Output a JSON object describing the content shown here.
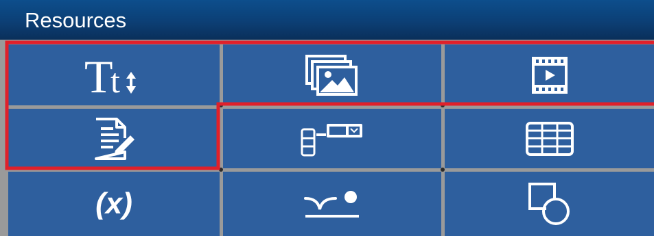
{
  "panel": {
    "title": "Resources"
  },
  "colors": {
    "header_top": "#0d4e8c",
    "header_bottom": "#0a2f5a",
    "tile": "#2e5f9e",
    "grid_line": "#9a9a9a",
    "selection": "#e0202a",
    "icon": "#ffffff"
  },
  "tiles": [
    {
      "icon": "text-size-icon"
    },
    {
      "icon": "image-gallery-icon"
    },
    {
      "icon": "video-icon"
    },
    {
      "icon": "document-edit-icon"
    },
    {
      "icon": "form-control-icon"
    },
    {
      "icon": "table-icon"
    },
    {
      "icon": "variable-icon",
      "text": "(x)"
    },
    {
      "icon": "path-point-icon"
    },
    {
      "icon": "shapes-icon"
    }
  ]
}
